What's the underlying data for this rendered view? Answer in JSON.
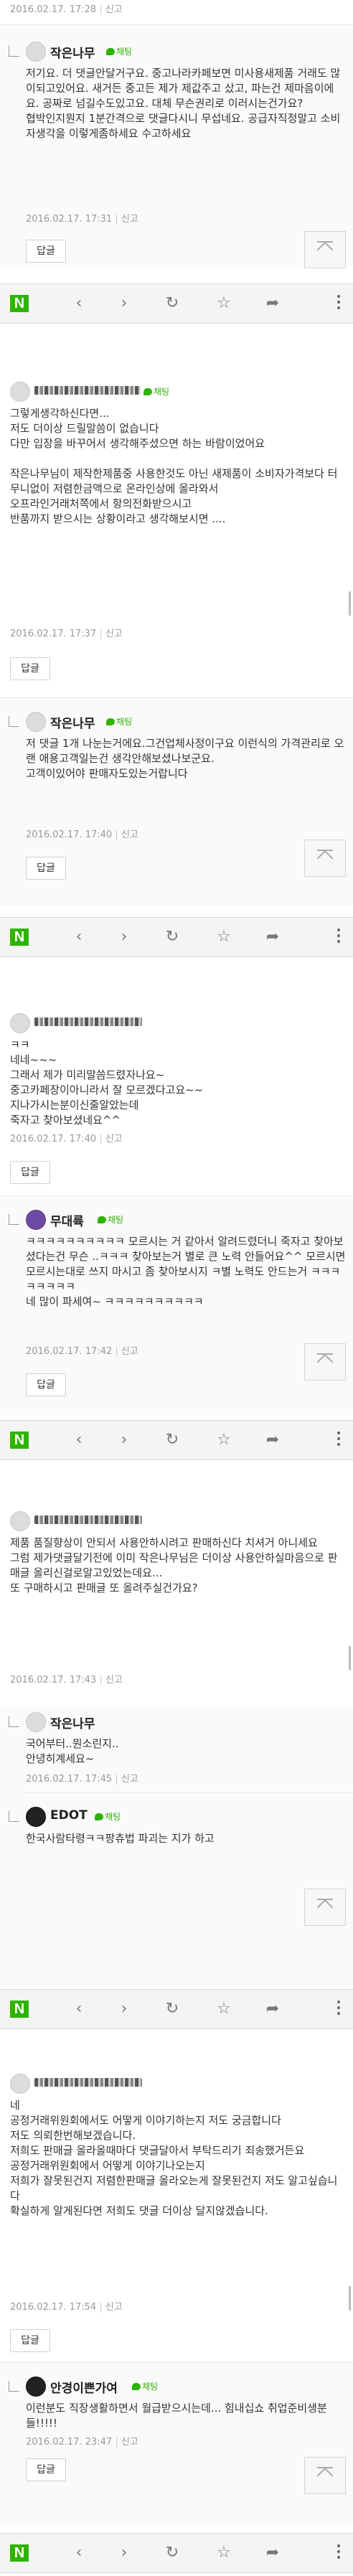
{
  "nav": {
    "logo": "N",
    "back_glyph": "‹",
    "forward_glyph": "›",
    "refresh_glyph": "↻",
    "favorite_glyph": "☆",
    "share_glyph": "➦",
    "icons": [
      "naver-logo",
      "back-icon",
      "forward-icon",
      "refresh-icon",
      "star-icon",
      "share-icon",
      "more-icon"
    ]
  },
  "reply_label": "답글",
  "report_label": "신고",
  "badge_label": "채팅",
  "brand_color": "#2db400",
  "screens": [
    {
      "comments": [
        {
          "time": "2016.02.17. 17:28"
        },
        {
          "author": "작은나무",
          "body": "저기요. 더 댓글안달거구요. 중고나라카페보면 미사용새제품 거래도 많이되고있어요. 새거든 중고든 제가 제값주고 샀고, 파는건 제마음이에요. 공짜로 넘길수도있고요. 대체 무슨권리로 이러시는건가요?\n협박인지뭔지 1분간격으로 댓글다시니 무섭네요. 공급자직정말고 소비자생각을 이렇게좀하세요 수고하세요",
          "time": "2016.02.17. 17:31"
        }
      ]
    },
    {
      "comments": [
        {
          "body": "그렇게생각하신다면...\n저도 더이상 드릴말씀이 없습니다\n다만 입장을 바꾸어서 생각해주셨으면 하는 바람이었어요\n\n작은나무님이 제작한제품중 사용한것도 아닌 새제품이 소비자가격보다 터무니없이 저렴한금액으로 온라인상에 올라와서\n오프라인거래처쪽에서 항의전화받으시고\n반품까지 받으시는 상황이라고 생각해보시면 ....",
          "time": "2016.02.17. 17:37"
        },
        {
          "author": "작은나무",
          "body": "저 댓글 1개 나눈는거에요.그건업체사정이구요 이런식의 가격관리로 오랜 애용고객일는건 생각안해보셨나보군요.\n고객이있어야 판매자도있는거랍니다",
          "time": "2016.02.17. 17:40"
        }
      ]
    },
    {
      "comments": [
        {
          "body": "ㅋㅋ\n네네~~~\n그래서 제가 미리말씀드렸자나요~\n중고카페장이아니라서 잘 모르겠다고요~~\n지나가시는분이신줄알았는데\n죽자고 찾아보셨네요^^",
          "time": "2016.02.17. 17:40"
        },
        {
          "author": "무대륙",
          "body": "ㅋㅋㅋㅋㅋㅋㅋㅋㅋㅋ 모르시는 거 같아서 알려드렸더니 죽자고 찾아보셨다는건 무슨 ..ㅋㅋㅋ 찾아보는거 별로 큰 노력 안들어요^^ 모르시면 모르시는대로 쓰지 마시고 좀 찾아보시지 ㅋ별 노력도 안드는거 ㅋㅋㅋㅋㅋㅋㅋㅋ\n네 많이 파세여~ ㅋㅋㅋㅋㅋㅋㅋㅋㅋㅋ",
          "time": "2016.02.17. 17:42"
        }
      ]
    },
    {
      "comments": [
        {
          "body": "제품 품질향상이 안되서 사용안하시려고 판매하신다 치셔거 아니세요\n그럼 제가댓글달기전에 이미 작은나무님은 더이상 사용안하실마음으로 판매글 올리신걸로알고있었는데요...\n또 구매하시고 판매글 또 올려주실건가요?",
          "time": "2016.02.17. 17:43"
        },
        {
          "author": "작은나무",
          "body": "국어부터..뭔소린지..\n안녕히계세요~",
          "time": "2016.02.17. 17:45"
        },
        {
          "author": "EDOT",
          "body": "한국사람타령ㅋㅋ팡츄법 파괴는 지가 하고"
        }
      ]
    },
    {
      "comments": [
        {
          "body": "네\n공정거래위원회에서도 어떻게 이야기하는지 저도 궁금합니다\n저도 의뢰한번해보겠습니다.\n저희도 판매글 올라올때마다 댓글달아서 부탁드리기 죄송했거든요\n공정거래위원회에서 어떻게 이야기나오는지\n저희가 잘못된건지 저렴한판매글 올라오는게 잘못된건지 저도 알고싶습니다\n확실하게 알게된다면 저희도 댓글 더이상 달지않겠습니다.",
          "time": "2016.02.17. 17:54"
        },
        {
          "author": "안경이쁜가여",
          "body": "이런분도 직장생활하면서 월급받으시는데... 힘내십쇼 취업준비생분들!!!!!",
          "time": "2016.02.17. 23:47"
        }
      ]
    }
  ]
}
